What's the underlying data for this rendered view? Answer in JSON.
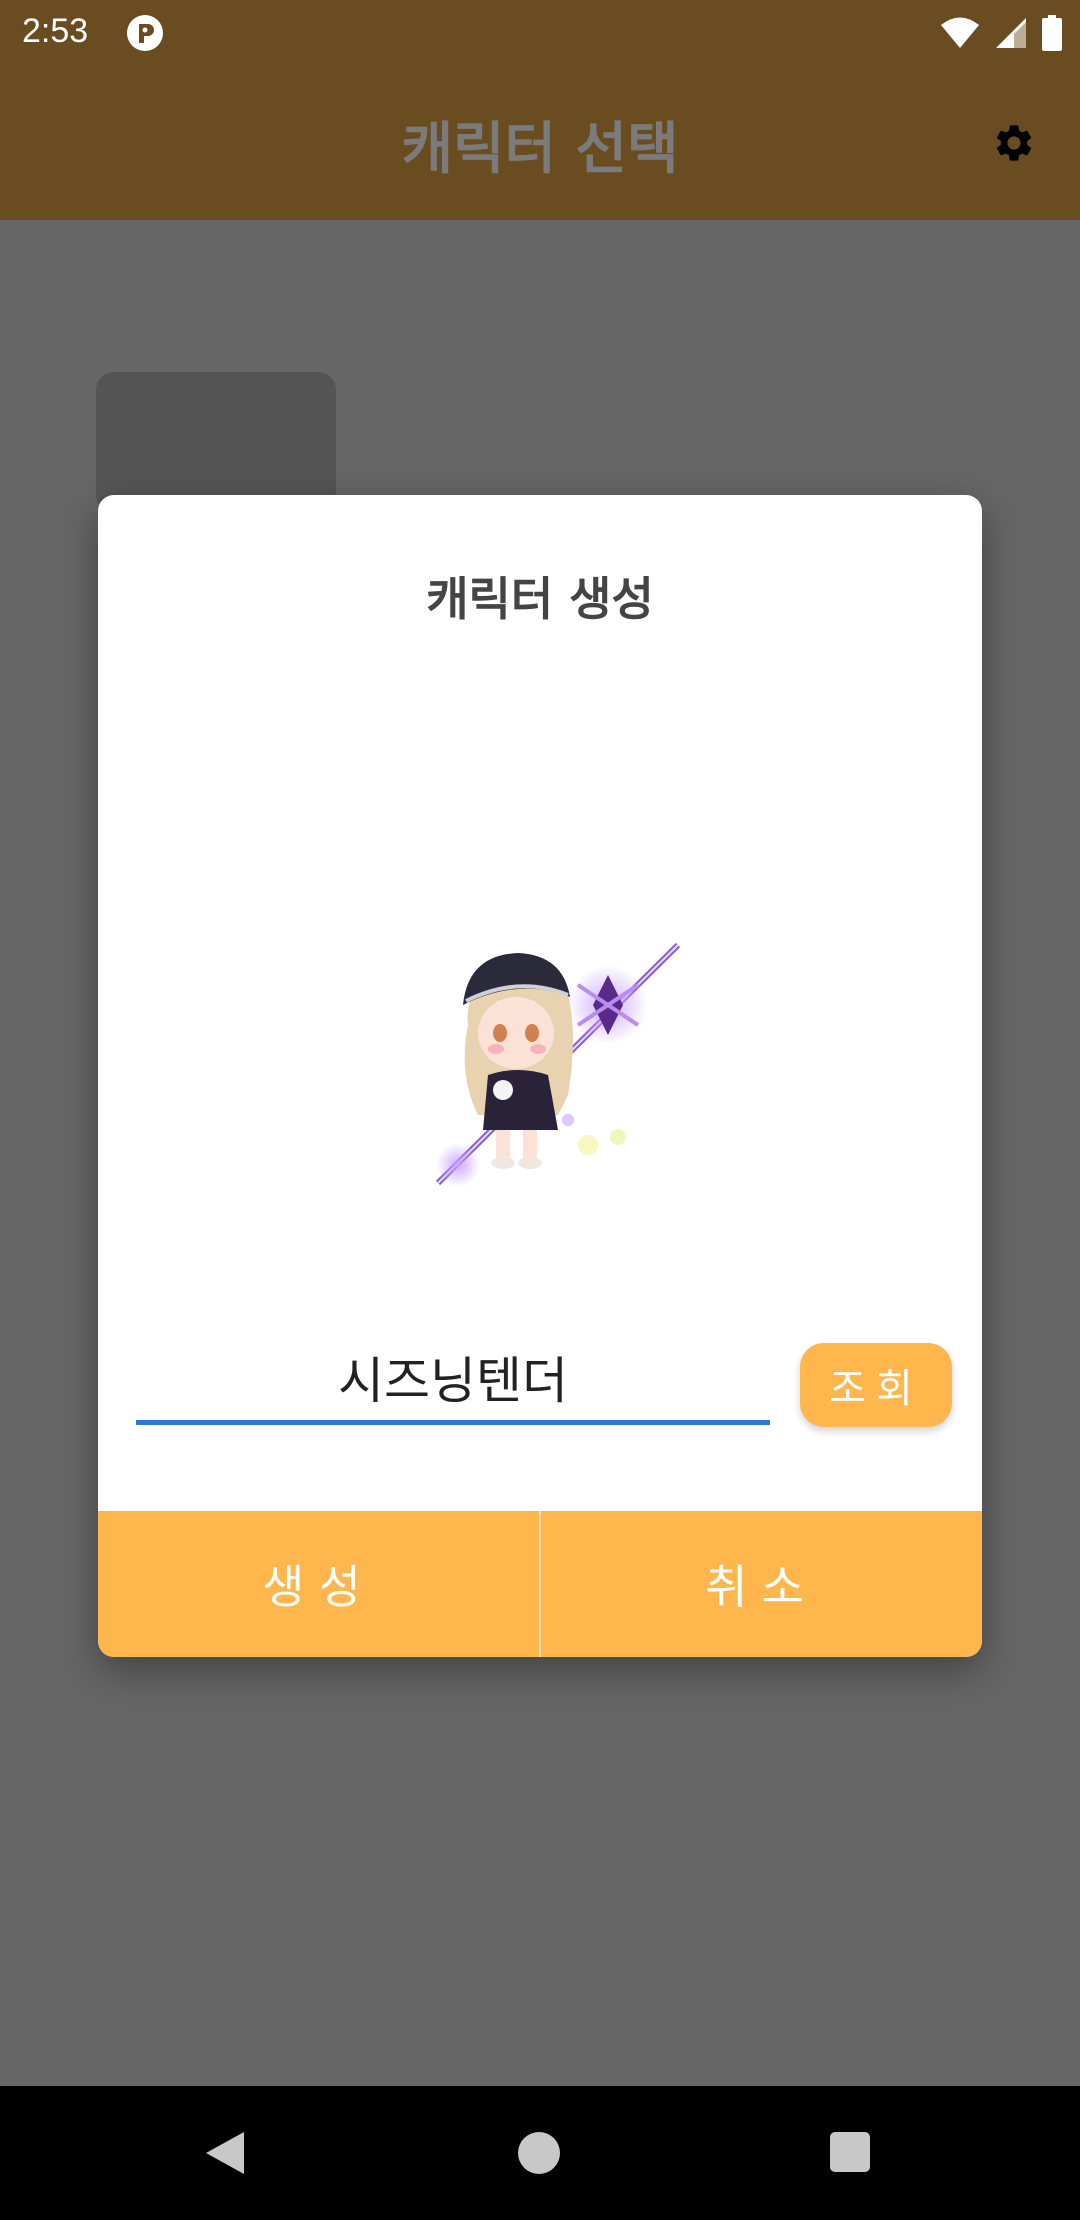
{
  "status_bar": {
    "time": "2:53"
  },
  "app_bar": {
    "title": "캐릭터 선택"
  },
  "dialog": {
    "title": "캐릭터 생성",
    "name_input_value": "시즈닝텐더",
    "lookup_label": "조회",
    "create_label": "생성",
    "cancel_label": "취소"
  },
  "colors": {
    "app_bar": "#6a4c21",
    "accent_button": "#ffb74d",
    "input_underline": "#2b78d6",
    "scrim": "#666666"
  },
  "icons": [
    "wifi-icon",
    "cellular-icon",
    "battery-icon",
    "settings-icon",
    "nav-back-icon",
    "nav-home-icon",
    "nav-recents-icon"
  ]
}
